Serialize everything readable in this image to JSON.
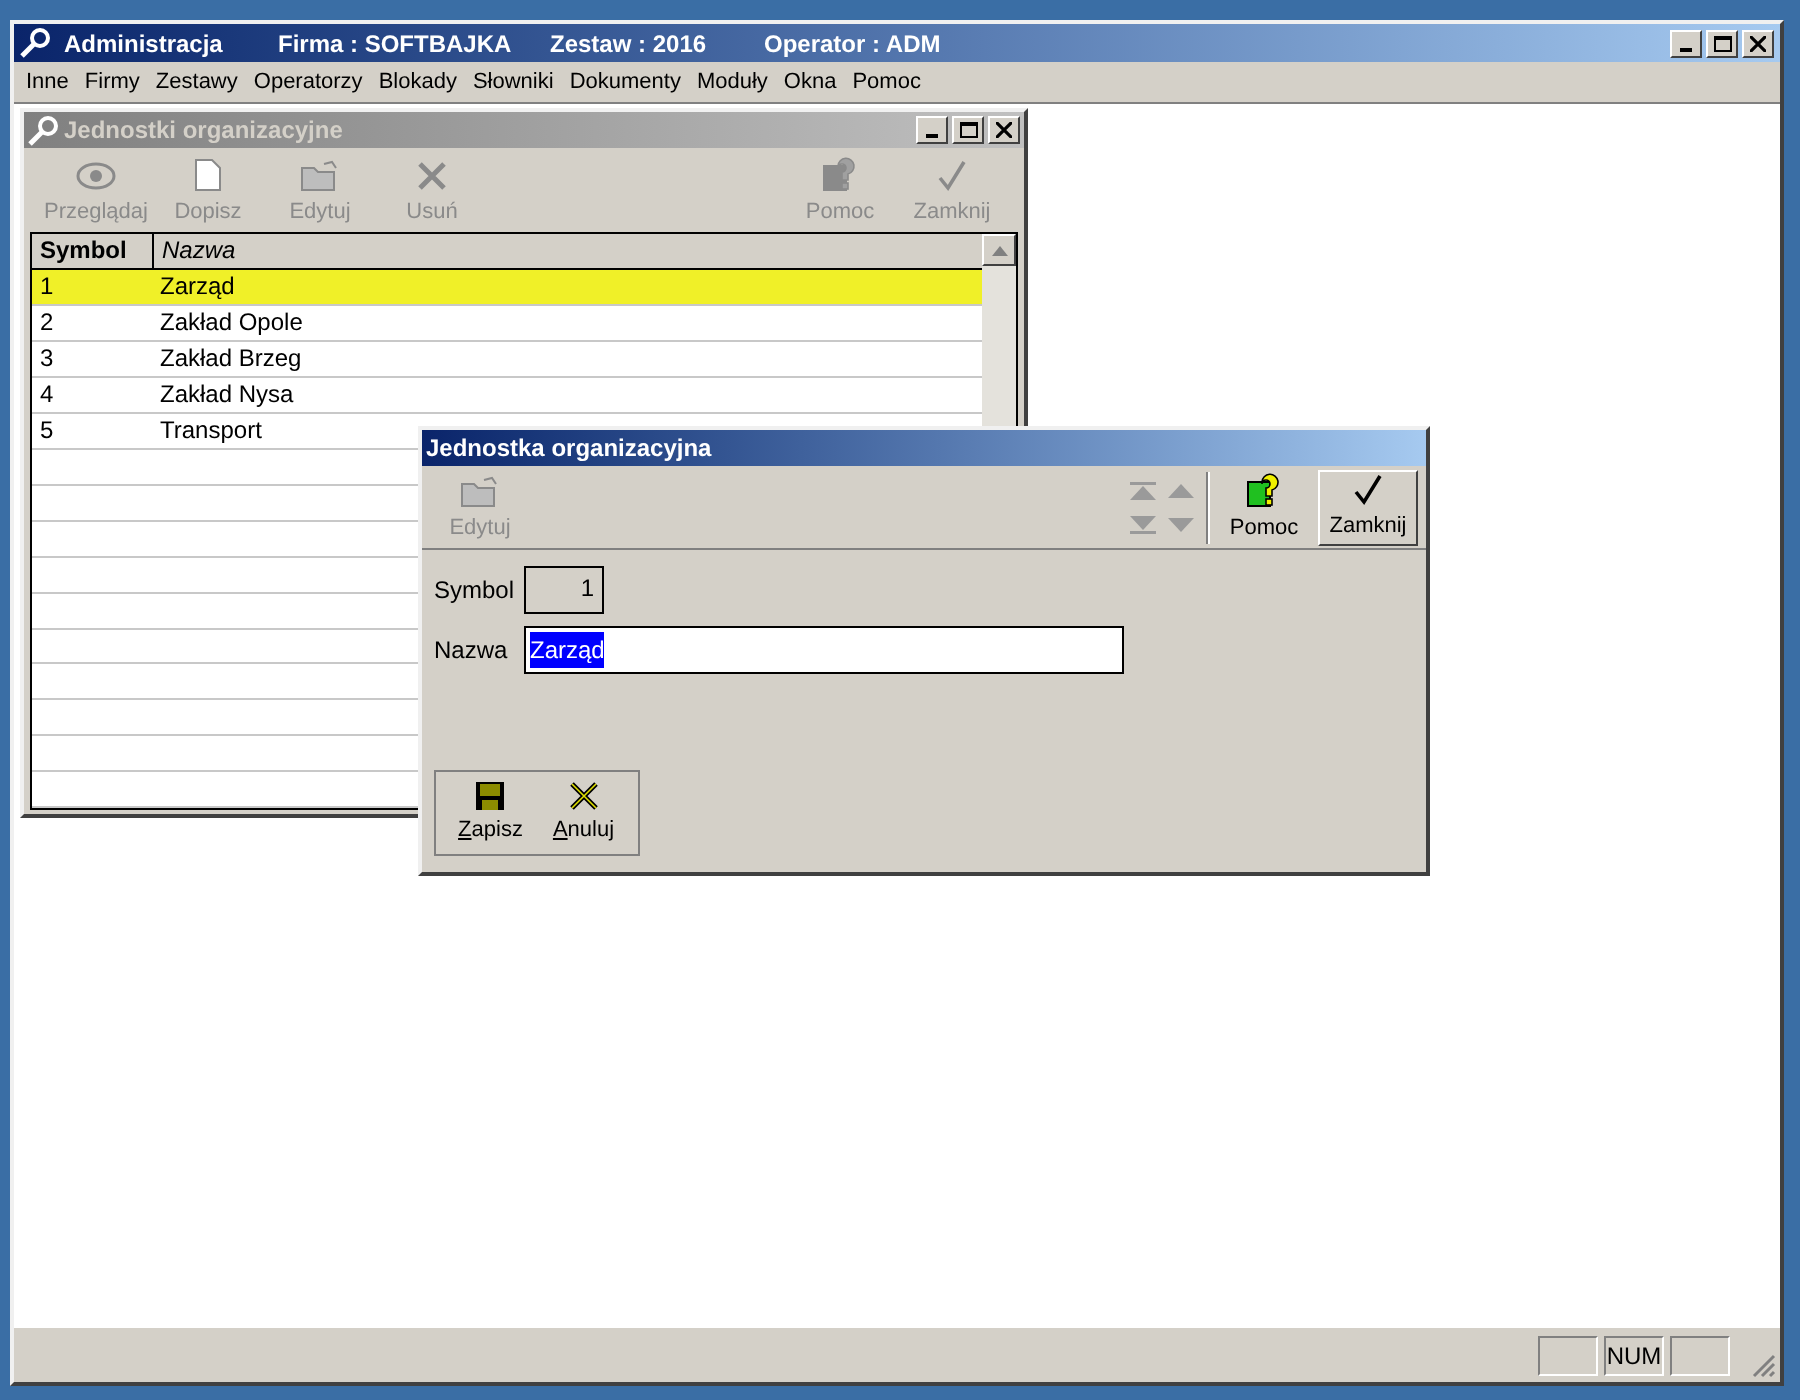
{
  "window": {
    "title_parts": [
      "Administracja",
      "Firma : SOFTBAJKA",
      "Zestaw : 2016",
      "Operator : ADM"
    ]
  },
  "menu": [
    "Inne",
    "Firmy",
    "Zestawy",
    "Operatorzy",
    "Blokady",
    "Słowniki",
    "Dokumenty",
    "Moduły",
    "Okna",
    "Pomoc"
  ],
  "list_window": {
    "title": "Jednostki organizacyjne",
    "active": false,
    "toolbar": [
      {
        "label": "Przeglądaj",
        "kind": "eye",
        "disabled": true
      },
      {
        "label": "Dopisz",
        "kind": "page",
        "disabled": true
      },
      {
        "label": "Edytuj",
        "kind": "folder",
        "disabled": true
      },
      {
        "label": "Usuń",
        "kind": "cross",
        "disabled": true
      },
      {
        "label": "Pomoc",
        "kind": "help",
        "disabled": true
      },
      {
        "label": "Zamknij",
        "kind": "check",
        "disabled": true
      }
    ],
    "table": {
      "columns": [
        "Symbol",
        "Nazwa"
      ],
      "rows": [
        {
          "symbol": "1",
          "name": "Zarząd",
          "selected": true
        },
        {
          "symbol": "2",
          "name": "Zakład Opole",
          "selected": false
        },
        {
          "symbol": "3",
          "name": "Zakład Brzeg",
          "selected": false
        },
        {
          "symbol": "4",
          "name": "Zakład Nysa",
          "selected": false
        },
        {
          "symbol": "5",
          "name": "Transport",
          "selected": false
        }
      ]
    }
  },
  "dialog": {
    "title": "Jednostka organizacyjna",
    "active": true,
    "toolbar": [
      {
        "label": "Edytuj",
        "kind": "folder",
        "disabled": true
      },
      {
        "label": "Pomoc",
        "kind": "help",
        "disabled": false
      },
      {
        "label": "Zamknij",
        "kind": "check",
        "disabled": false
      }
    ],
    "navigation_disabled": true,
    "fields": [
      {
        "label": "Symbol",
        "value": "1",
        "kind": "readonly"
      },
      {
        "label": "Nazwa",
        "value": "Zarząd",
        "kind": "text",
        "selected": true
      }
    ],
    "buttons": [
      {
        "label": "Zapisz",
        "kind": "save"
      },
      {
        "label": "Anuluj",
        "kind": "cancel"
      }
    ]
  },
  "status_bar": {
    "num_indicator": "NUM"
  }
}
